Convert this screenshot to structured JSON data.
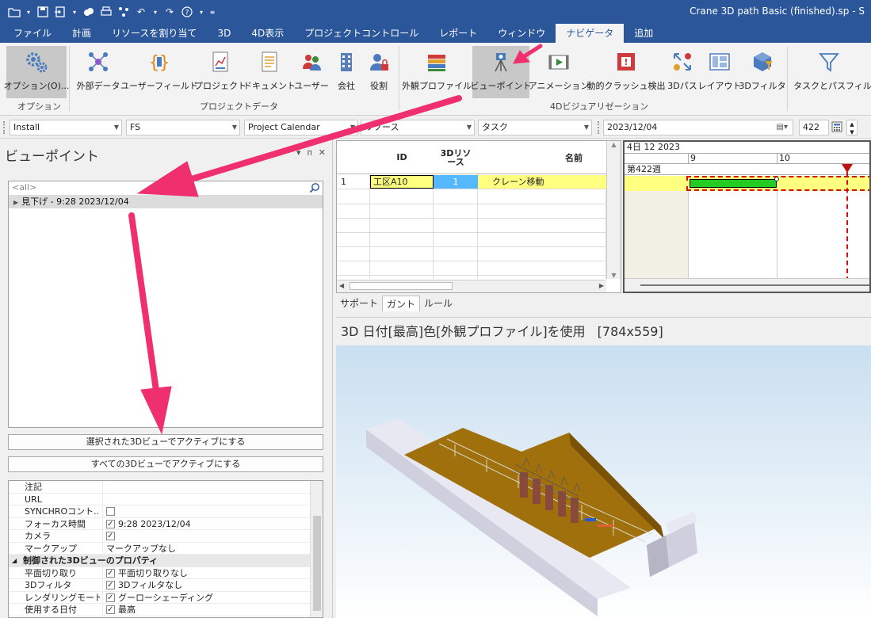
{
  "window": {
    "title": "Crane 3D path Basic (finished).sp - S"
  },
  "menu_tabs": [
    {
      "label": "ファイル"
    },
    {
      "label": "計画"
    },
    {
      "label": "リソースを割り当て"
    },
    {
      "label": "3D"
    },
    {
      "label": "4D表示"
    },
    {
      "label": "プロジェクトコントロール"
    },
    {
      "label": "レポート"
    },
    {
      "label": "ウィンドウ"
    },
    {
      "label": "ナビゲータ",
      "active": true
    },
    {
      "label": "追加"
    }
  ],
  "ribbon": {
    "options_label": "オプション(O)...",
    "options_group": "オプション",
    "project_data_group": "プロジェクトデータ",
    "viz_group": "4Dビジュアリゼーション",
    "buttons": {
      "external_data": "外部データ",
      "user_field": "ユーザーフィールド",
      "project": "プロジェクト",
      "document": "ドキュメント",
      "user": "ユーザー",
      "company": "会社",
      "role": "役割",
      "appearance_profile": "外観プロファイル",
      "viewpoint": "ビューポイント",
      "animation": "アニメーション",
      "dynamic_clash": "動的クラッシュ検出",
      "path_3d": "3Dパス",
      "layout": "レイアウト",
      "filter_3d": "3Dフィルタ",
      "task_path_filter": "タスクとパスフィルタ"
    }
  },
  "filterbar": {
    "install": "Install",
    "fs": "FS",
    "calendar": "Project Calendar",
    "resource": "リソース",
    "task": "タスク",
    "date": "2023/12/04",
    "number": "422"
  },
  "left_panel": {
    "title": "ビューポイント",
    "search_placeholder": "<all>",
    "tree_item": "見下げ - 9:28 2023/12/04",
    "btn_activate_selected": "選択された3Dビューでアクティブにする",
    "btn_activate_all": "すべての3Dビューでアクティブにする",
    "properties": [
      {
        "name": "注記",
        "value": ""
      },
      {
        "name": "URL",
        "value": ""
      },
      {
        "name": "SYNCHROコント...",
        "value": "",
        "check": "off"
      },
      {
        "name": "フォーカス時間",
        "value": "9:28 2023/12/04",
        "check": "on"
      },
      {
        "name": "カメラ",
        "value": "",
        "check": "on"
      },
      {
        "name": "マークアップ",
        "value": "マークアップなし"
      },
      {
        "name": "制御された3Dビューのプロパティ",
        "value": "",
        "category": true
      },
      {
        "name": "平面切り取り",
        "value": "平面切り取りなし",
        "check": "on"
      },
      {
        "name": "3Dフィルタ",
        "value": "3Dフィルタなし",
        "check": "on"
      },
      {
        "name": "レンダリングモード",
        "value": "グーローシェーディング",
        "check": "on"
      },
      {
        "name": "使用する日付",
        "value": "最高",
        "check": "on"
      }
    ]
  },
  "grid": {
    "headers": {
      "id": "ID",
      "resource": "3Dリソース",
      "name": "名前"
    },
    "rows": [
      {
        "num": "1",
        "id": "工区A10",
        "resource": "1",
        "name": "クレーン移動"
      }
    ]
  },
  "gantt": {
    "month": "4日 12 2023",
    "day9": "9",
    "day10": "10",
    "week": "第422週"
  },
  "bottom_tabs": [
    {
      "label": "サポート"
    },
    {
      "label": "ガント",
      "active": true
    },
    {
      "label": "ルール"
    }
  ],
  "view3d": {
    "title": "3D 日付[最高]色[外観プロファイル]を使用",
    "size": "[784x559]"
  },
  "colors": {
    "accent": "#2b579a",
    "annotation_arrow": "#f0306e",
    "task_bar": "#22cc22",
    "row_highlight": "#ffff80",
    "resource_cell": "#55b8ff",
    "ground": "#a0700c"
  }
}
